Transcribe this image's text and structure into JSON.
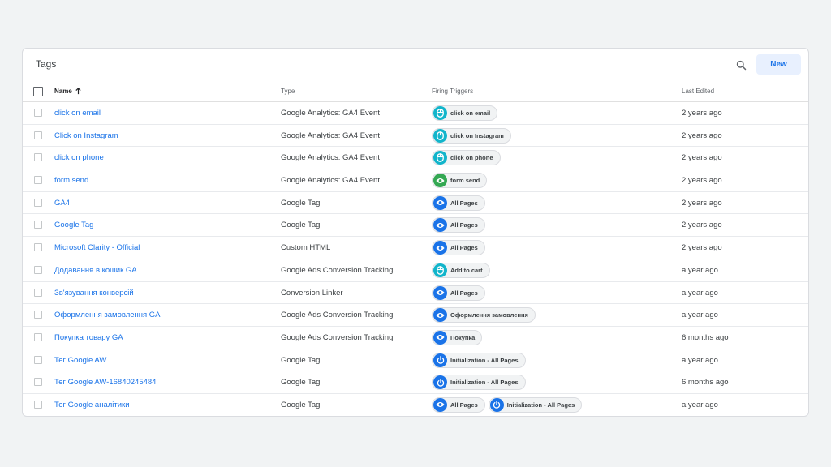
{
  "header": {
    "title": "Tags",
    "new_label": "New",
    "search_icon": "search-icon"
  },
  "columns": {
    "name": "Name",
    "type": "Type",
    "triggers": "Firing Triggers",
    "edited": "Last Edited"
  },
  "colors": {
    "accent": "#1a73e8",
    "click_trigger": "#12b5cb",
    "form_trigger": "#34a853",
    "pageview_trigger": "#1a73e8"
  },
  "rows": [
    {
      "name": "click on email",
      "type": "Google Analytics: GA4 Event",
      "triggers": [
        {
          "kind": "click",
          "label": "click on email"
        }
      ],
      "edited": "2 years ago"
    },
    {
      "name": "Click on Instagram",
      "type": "Google Analytics: GA4 Event",
      "triggers": [
        {
          "kind": "click",
          "label": "click on Instagram"
        }
      ],
      "edited": "2 years ago"
    },
    {
      "name": "click on phone",
      "type": "Google Analytics: GA4 Event",
      "triggers": [
        {
          "kind": "click",
          "label": "click on phone"
        }
      ],
      "edited": "2 years ago"
    },
    {
      "name": "form send",
      "type": "Google Analytics: GA4 Event",
      "triggers": [
        {
          "kind": "form",
          "label": "form send"
        }
      ],
      "edited": "2 years ago"
    },
    {
      "name": "GA4",
      "type": "Google Tag",
      "triggers": [
        {
          "kind": "pageview",
          "label": "All Pages"
        }
      ],
      "edited": "2 years ago"
    },
    {
      "name": "Google Tag",
      "type": "Google Tag",
      "triggers": [
        {
          "kind": "pageview",
          "label": "All Pages"
        }
      ],
      "edited": "2 years ago"
    },
    {
      "name": "Microsoft Clarity - Official",
      "type": "Custom HTML",
      "triggers": [
        {
          "kind": "pageview",
          "label": "All Pages"
        }
      ],
      "edited": "2 years ago"
    },
    {
      "name": "Додавання в кошик GA",
      "type": "Google Ads Conversion Tracking",
      "triggers": [
        {
          "kind": "click",
          "label": "Add to cart"
        }
      ],
      "edited": "a year ago"
    },
    {
      "name": "Зв'язування конверсій",
      "type": "Conversion Linker",
      "triggers": [
        {
          "kind": "pageview",
          "label": "All Pages"
        }
      ],
      "edited": "a year ago"
    },
    {
      "name": "Оформлення замовлення GA",
      "type": "Google Ads Conversion Tracking",
      "triggers": [
        {
          "kind": "pageview",
          "label": "Оформлення замовлення"
        }
      ],
      "edited": "a year ago"
    },
    {
      "name": "Покупка товару GA",
      "type": "Google Ads Conversion Tracking",
      "triggers": [
        {
          "kind": "pageview",
          "label": "Покупка"
        }
      ],
      "edited": "6 months ago"
    },
    {
      "name": "Тег Google AW",
      "type": "Google Tag",
      "triggers": [
        {
          "kind": "init",
          "label": "Initialization - All Pages"
        }
      ],
      "edited": "a year ago"
    },
    {
      "name": "Тег Google AW-16840245484",
      "type": "Google Tag",
      "triggers": [
        {
          "kind": "init",
          "label": "Initialization - All Pages"
        }
      ],
      "edited": "6 months ago"
    },
    {
      "name": "Тег Google аналітики",
      "type": "Google Tag",
      "triggers": [
        {
          "kind": "pageview",
          "label": "All Pages"
        },
        {
          "kind": "init",
          "label": "Initialization - All Pages"
        }
      ],
      "edited": "a year ago"
    }
  ]
}
